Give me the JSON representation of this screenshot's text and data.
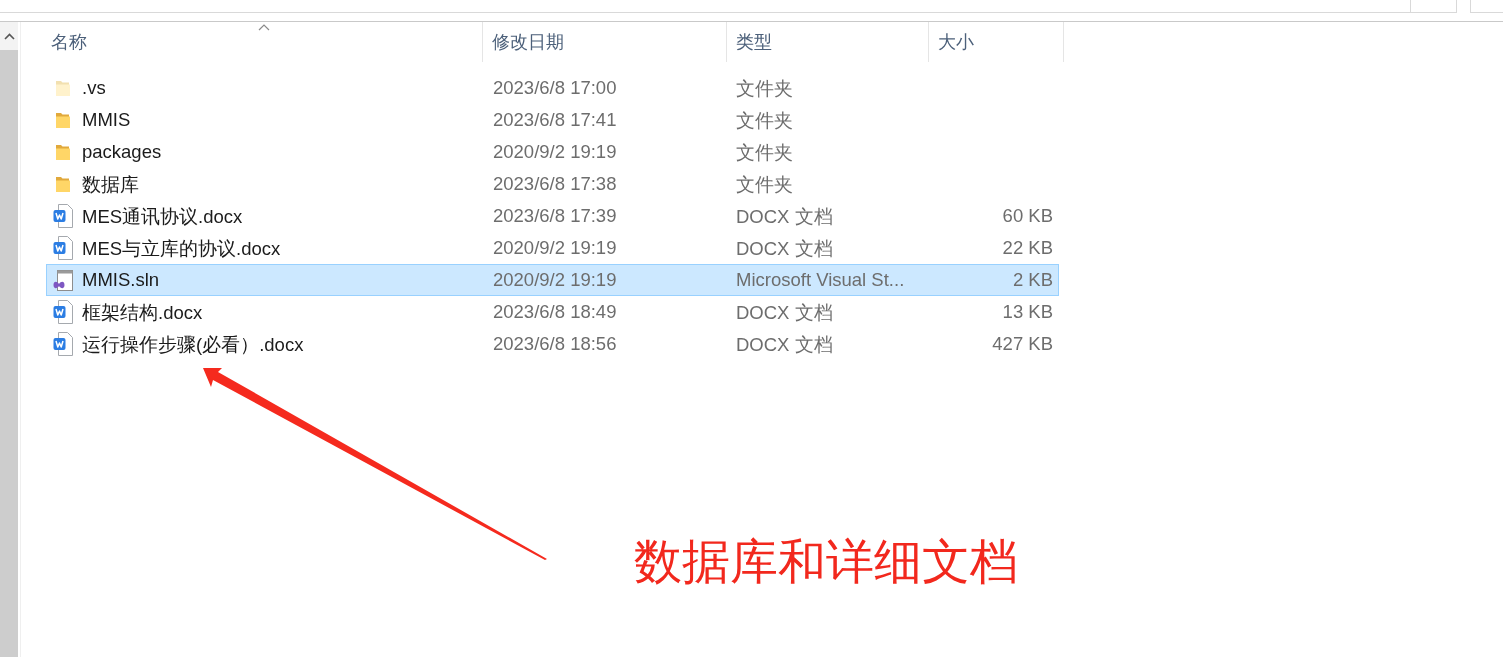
{
  "file_list": {
    "columns": [
      {
        "label": "名称",
        "sorted": true
      },
      {
        "label": "修改日期",
        "sorted": false
      },
      {
        "label": "类型",
        "sorted": false
      },
      {
        "label": "大小",
        "sorted": false
      }
    ],
    "rows": [
      {
        "kind": "folder",
        "name": ".vs",
        "hidden": true,
        "modified": "2023/6/8 17:00",
        "type": "文件夹",
        "selected": false
      },
      {
        "kind": "folder",
        "name": "MMIS",
        "hidden": false,
        "modified": "2023/6/8 17:41",
        "type": "文件夹",
        "selected": false
      },
      {
        "kind": "folder",
        "name": "packages",
        "hidden": false,
        "modified": "2020/9/2 19:19",
        "type": "文件夹",
        "selected": false
      },
      {
        "kind": "folder",
        "name": "数据库",
        "hidden": false,
        "modified": "2023/6/8 17:38",
        "type": "文件夹",
        "selected": false
      },
      {
        "kind": "docx",
        "name": "MES通讯协议.docx",
        "hidden": false,
        "modified": "2023/6/8 17:39",
        "type": "DOCX 文档",
        "size": "60 KB",
        "selected": false
      },
      {
        "kind": "docx",
        "name": "MES与立库的协议.docx",
        "hidden": false,
        "modified": "2020/9/2 19:19",
        "type": "DOCX 文档",
        "size": "22 KB",
        "selected": false
      },
      {
        "kind": "sln",
        "name": "MMIS.sln",
        "hidden": false,
        "modified": "2020/9/2 19:19",
        "type": "Microsoft Visual St...",
        "size": "2 KB",
        "selected": true
      },
      {
        "kind": "docx",
        "name": "框架结构.docx",
        "hidden": false,
        "modified": "2023/6/8 18:49",
        "type": "DOCX 文档",
        "size": "13 KB",
        "selected": false
      },
      {
        "kind": "docx",
        "name": "运行操作步骤(必看）.docx",
        "hidden": false,
        "modified": "2023/6/8 18:56",
        "type": "DOCX 文档",
        "size": "427 KB",
        "selected": false
      }
    ]
  },
  "annotation": {
    "text": "数据库和详细文档"
  }
}
